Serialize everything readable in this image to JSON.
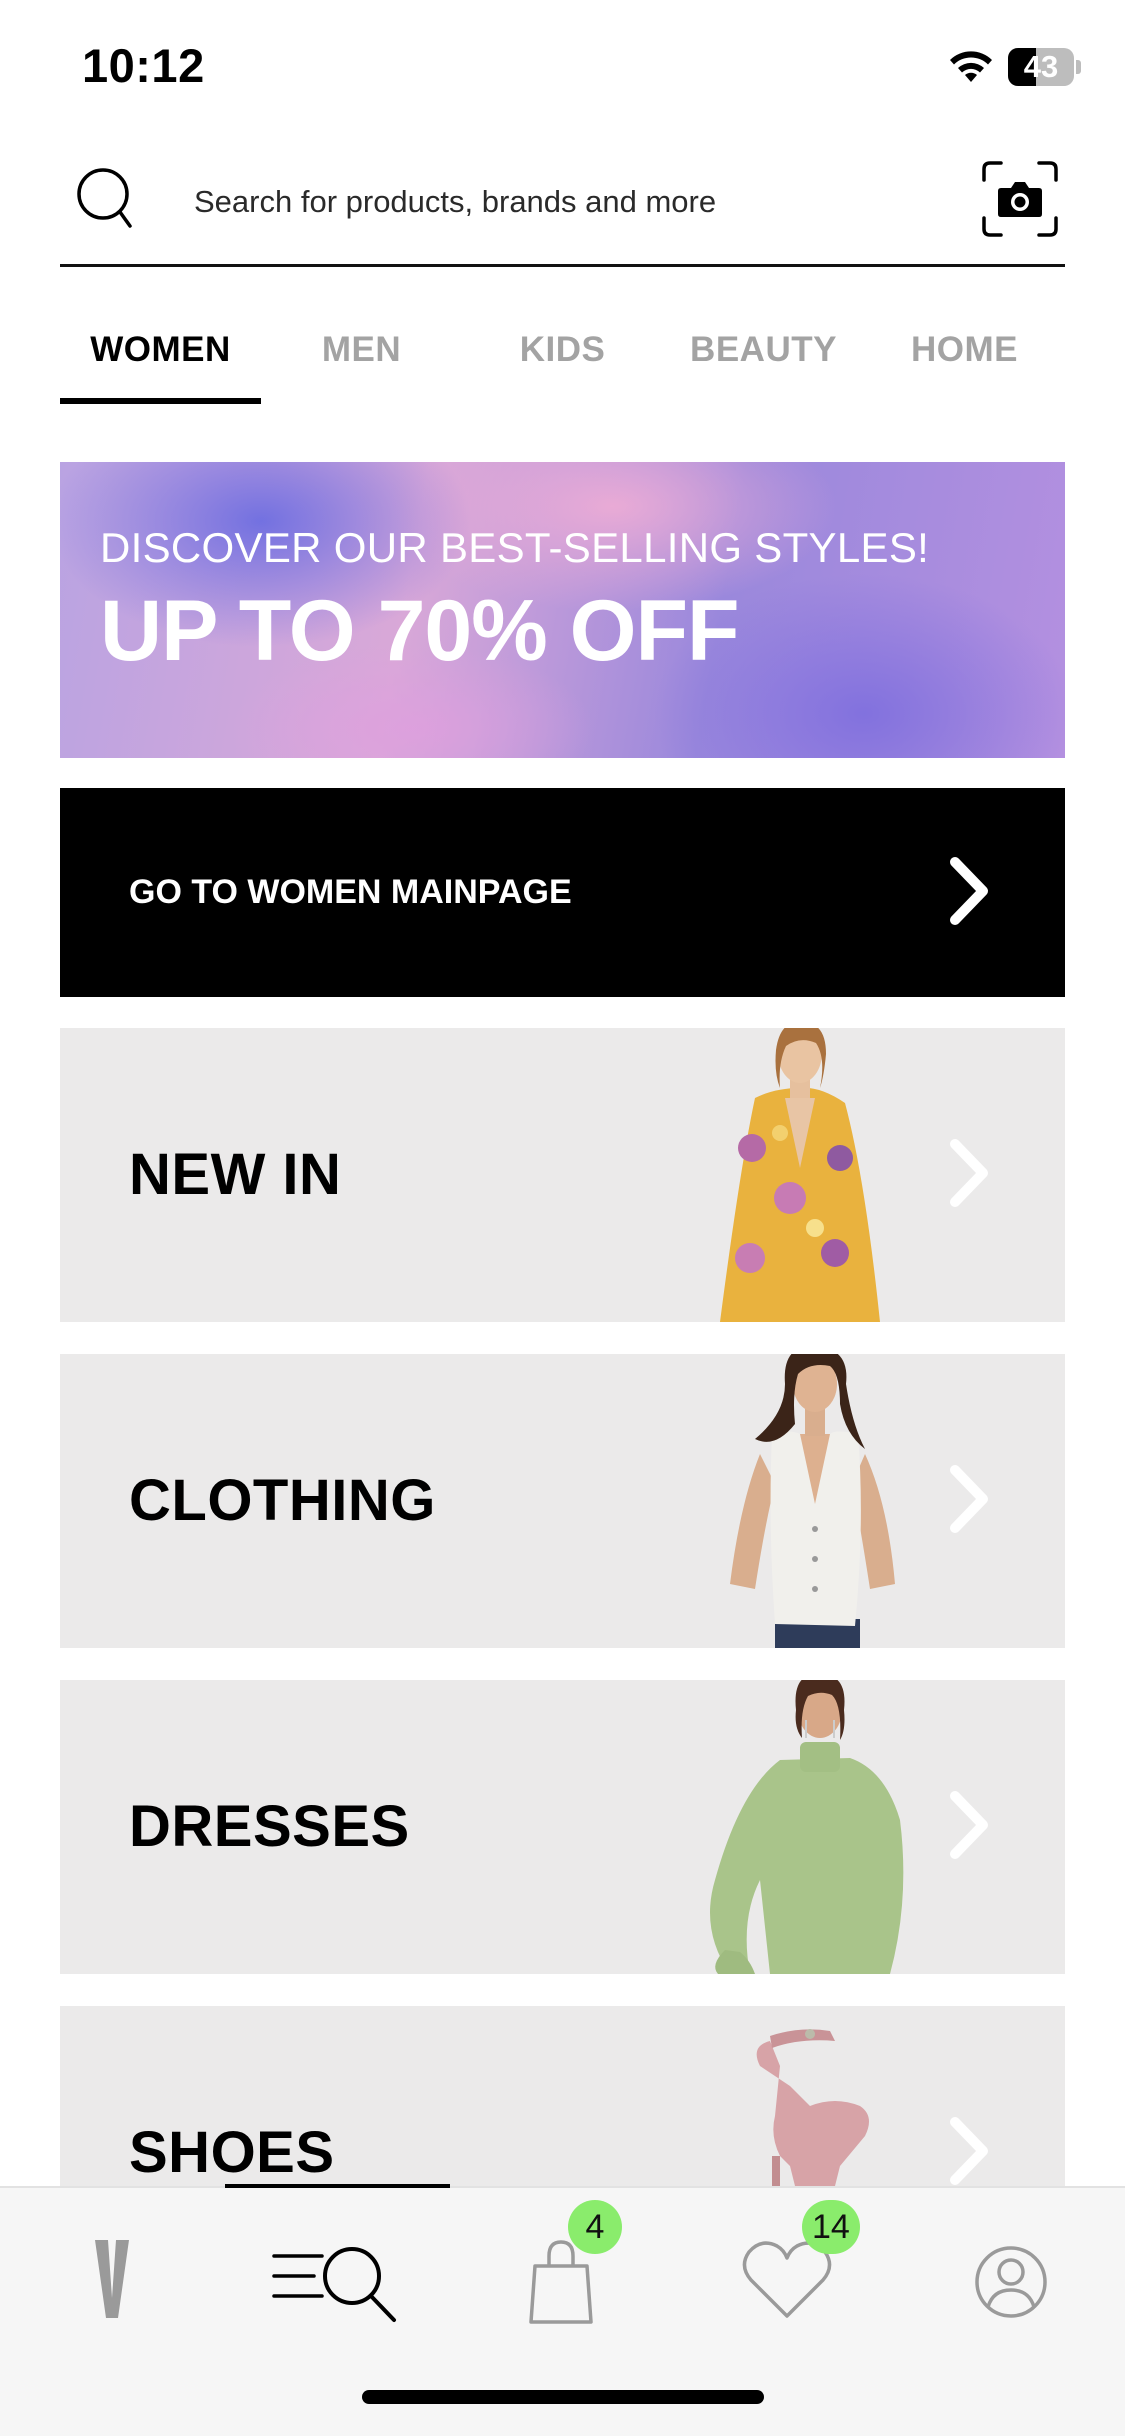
{
  "status_bar": {
    "time": "10:12",
    "battery_level": "43",
    "battery_fraction": 0.43,
    "icons": [
      "wifi-icon",
      "battery-icon"
    ]
  },
  "search": {
    "placeholder": "Search for products, brands and more",
    "value": "",
    "icons": [
      "search-icon",
      "camera-icon"
    ]
  },
  "tabs": [
    {
      "label": "WOMEN",
      "active": true
    },
    {
      "label": "MEN",
      "active": false
    },
    {
      "label": "KIDS",
      "active": false
    },
    {
      "label": "BEAUTY",
      "active": false
    },
    {
      "label": "HOME",
      "active": false
    }
  ],
  "promo": {
    "subtitle": "DISCOVER OUR BEST-SELLING STYLES!",
    "title": "UP TO 70% OFF"
  },
  "main_page_button": {
    "label": "GO TO WOMEN MAINPAGE"
  },
  "categories": [
    {
      "label": "NEW IN",
      "image": "model in floral blouse"
    },
    {
      "label": "CLOTHING",
      "image": "model in white vest"
    },
    {
      "label": "DRESSES",
      "image": "model in green blouse"
    },
    {
      "label": "SHOES",
      "image": "pink heeled sandal"
    }
  ],
  "bottom_nav": {
    "items": [
      {
        "name": "home",
        "icon": "logo-v-icon"
      },
      {
        "name": "categories",
        "icon": "menu-search-icon",
        "active": true
      },
      {
        "name": "bag",
        "icon": "bag-icon",
        "badge": "4"
      },
      {
        "name": "favorites",
        "icon": "heart-icon",
        "badge": "14"
      },
      {
        "name": "account",
        "icon": "user-icon"
      }
    ]
  },
  "colors": {
    "accent_badge": "#8aec6c",
    "card_background": "#ebeaea",
    "inactive_tab": "#a3a3a3"
  }
}
